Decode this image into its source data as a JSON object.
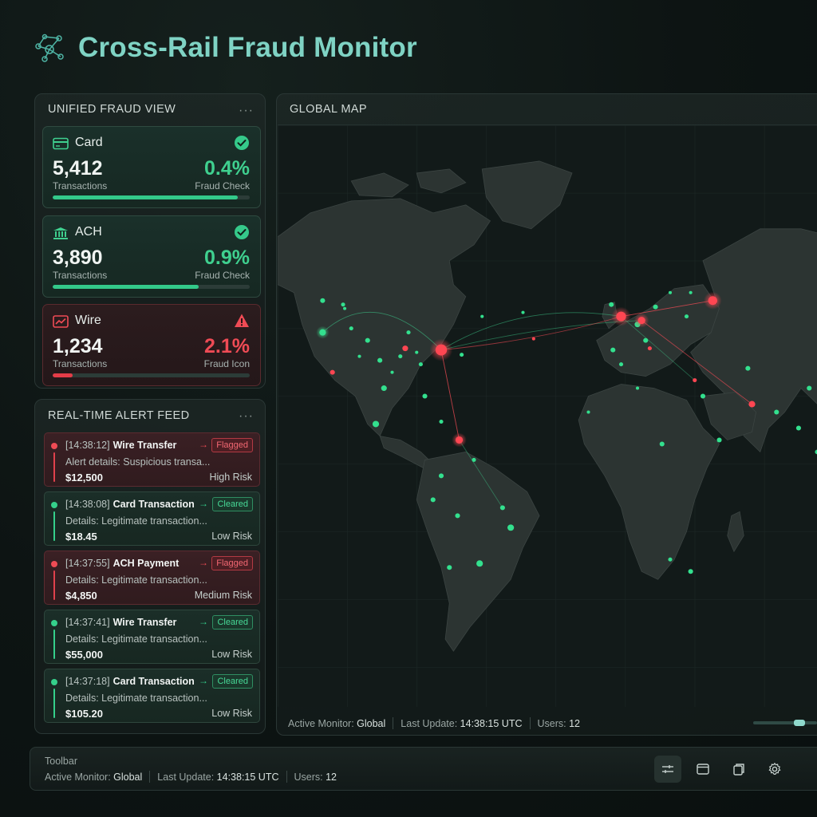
{
  "app": {
    "title": "Cross-Rail Fraud Monitor"
  },
  "unified": {
    "title": "UNIFIED FRAUD VIEW",
    "rails": [
      {
        "name": "Card",
        "icon": "credit-card-icon",
        "status": "ok",
        "count": "5,412",
        "count_label": "Transactions",
        "rate": "0.4%",
        "rate_label": "Fraud Check",
        "progress": 0.94
      },
      {
        "name": "ACH",
        "icon": "bank-icon",
        "status": "ok",
        "count": "3,890",
        "count_label": "Transactions",
        "rate": "0.9%",
        "rate_label": "Fraud Check",
        "progress": 0.74
      },
      {
        "name": "Wire",
        "icon": "trend-chart-icon",
        "status": "warning",
        "count": "1,234",
        "count_label": "Transactions",
        "rate": "2.1%",
        "rate_label": "Fraud Icon",
        "progress": 0.1
      }
    ]
  },
  "feed": {
    "title": "REAL-TIME ALERT FEED",
    "alerts": [
      {
        "time": "[14:38:12]",
        "type": "Wire Transfer",
        "status": "Flagged",
        "details": "Alert details: Suspicious transa...",
        "amount": "$12,500",
        "risk": "High Risk"
      },
      {
        "time": "[14:38:08]",
        "type": "Card Transaction",
        "status": "Cleared",
        "details": "Details: Legitimate transaction...",
        "amount": "$18.45",
        "risk": "Low Risk"
      },
      {
        "time": "[14:37:55]",
        "type": "ACH Payment",
        "status": "Flagged",
        "details": "Details: Legitimate transaction...",
        "amount": "$4,850",
        "risk": "Medium Risk"
      },
      {
        "time": "[14:37:41]",
        "type": "Wire Transfer",
        "status": "Cleared",
        "details": "Details: Legitimate transaction...",
        "amount": "$55,000",
        "risk": "Low Risk"
      },
      {
        "time": "[14:37:18]",
        "type": "Card Transaction",
        "status": "Cleared",
        "details": "Details: Legitimate transaction...",
        "amount": "$105.20",
        "risk": "Low Risk"
      }
    ]
  },
  "map": {
    "title": "GLOBAL MAP",
    "status": {
      "monitor_label": "Active Monitor:",
      "monitor_value": "Global",
      "update_label": "Last Update:",
      "update_value": "14:38:15 UTC",
      "users_label": "Users:",
      "users_value": "12"
    },
    "zoom_level": 0.78
  },
  "toolbar": {
    "label": "Toolbar",
    "status": {
      "monitor_label": "Active Monitor:",
      "monitor_value": "Global",
      "update_label": "Last Update:",
      "update_value": "14:38:15 UTC",
      "users_label": "Users:",
      "users_value": "12"
    },
    "buttons": [
      "filter-icon",
      "window-icon",
      "copy-icon",
      "settings-icon"
    ]
  },
  "colors": {
    "accent": "#7fd3c4",
    "ok": "#35d08b",
    "alert": "#ef4b55",
    "background": "#0d1413"
  }
}
